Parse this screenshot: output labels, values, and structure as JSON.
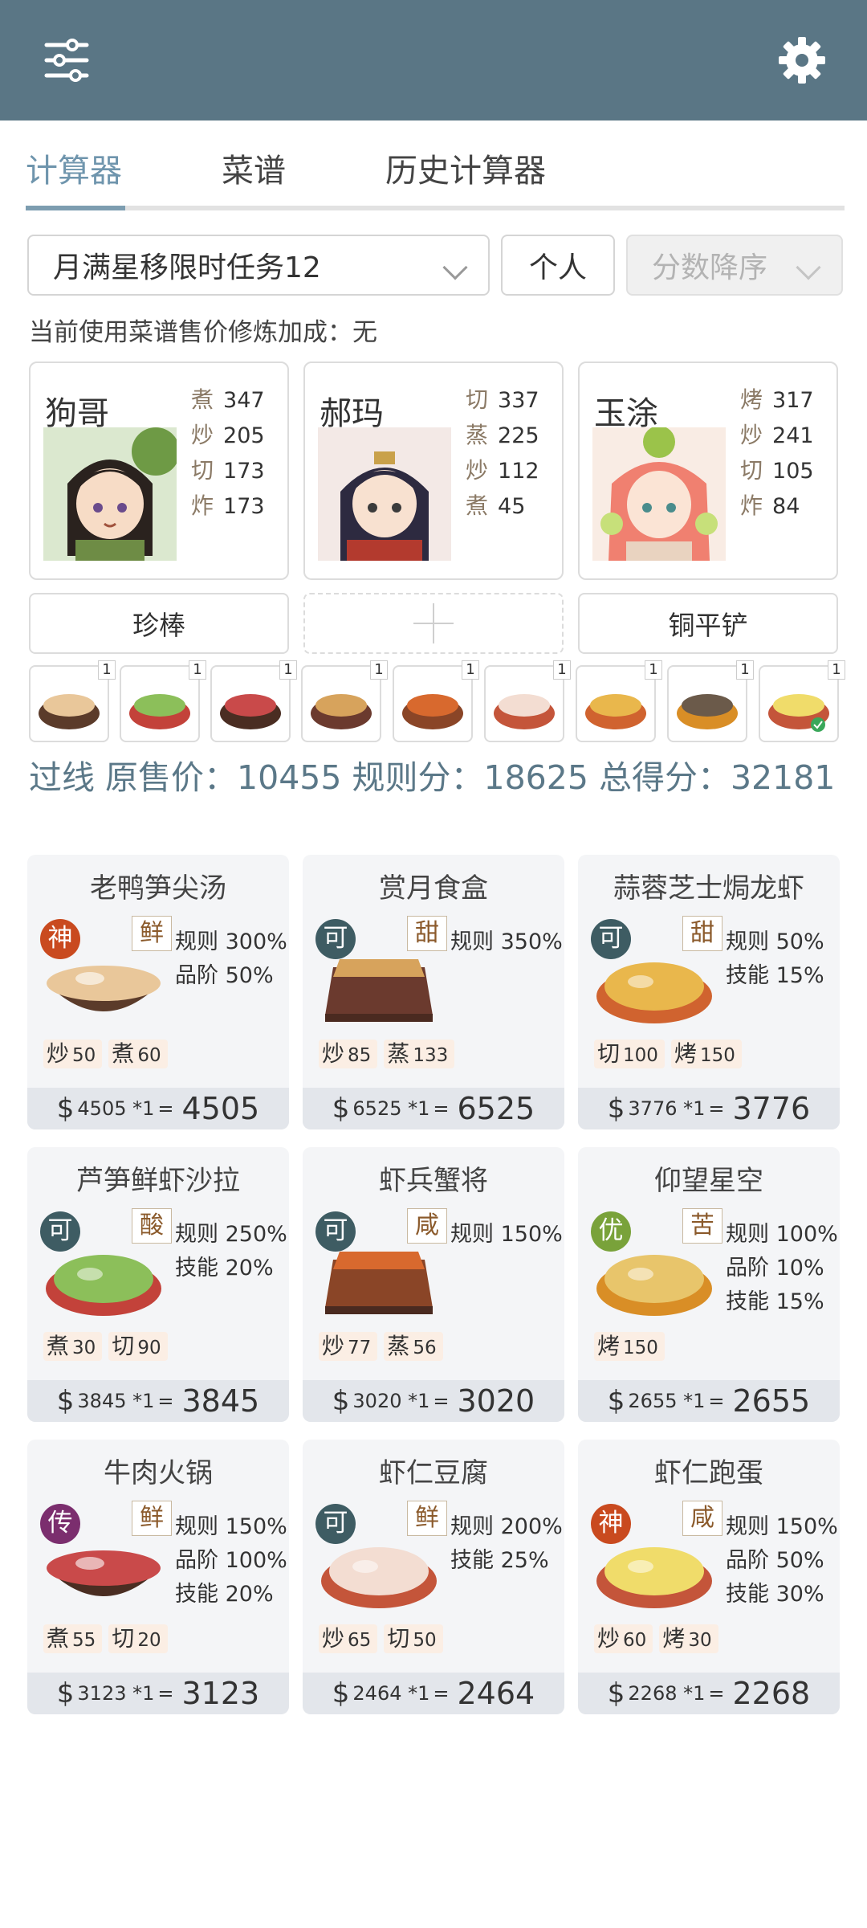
{
  "header": {
    "filter_icon": "sliders-icon",
    "settings_icon": "gear-icon"
  },
  "tabs": [
    {
      "label": "计算器",
      "active": true
    },
    {
      "label": "菜谱",
      "active": false
    },
    {
      "label": "历史计算器",
      "active": false
    }
  ],
  "controls": {
    "rule_select": "月满星移限时任务12",
    "mode_button": "个人",
    "sort_select": "分数降序"
  },
  "note": "当前使用菜谱售价修炼加成：无",
  "chefs": [
    {
      "name": "狗哥",
      "skills": [
        {
          "n": "煮",
          "v": "347"
        },
        {
          "n": "炒",
          "v": "205"
        },
        {
          "n": "切",
          "v": "173"
        },
        {
          "n": "炸",
          "v": "173"
        }
      ],
      "equip": "珍棒"
    },
    {
      "name": "郝玛",
      "skills": [
        {
          "n": "切",
          "v": "337"
        },
        {
          "n": "蒸",
          "v": "225"
        },
        {
          "n": "炒",
          "v": "112"
        },
        {
          "n": "煮",
          "v": "45"
        }
      ],
      "equip": ""
    },
    {
      "name": "玉涂",
      "skills": [
        {
          "n": "烤",
          "v": "317"
        },
        {
          "n": "炒",
          "v": "241"
        },
        {
          "n": "切",
          "v": "105"
        },
        {
          "n": "炸",
          "v": "84"
        }
      ],
      "equip": "铜平铲"
    }
  ],
  "slots": [
    "1",
    "1",
    "1",
    "1",
    "1",
    "1",
    "1",
    "1",
    "1"
  ],
  "summary": {
    "status": "过线",
    "text": " 原售价：10455 规则分：18625 总得分：32181"
  },
  "recipes": [
    {
      "name": "老鸭笋尖汤",
      "rarity": "神",
      "rcolor": "#c94a1f",
      "flavor": "鲜",
      "rules": [
        "规则 300%",
        "品阶 50%"
      ],
      "skills": [
        {
          "n": "炒",
          "v": "50"
        },
        {
          "n": "煮",
          "v": "60"
        }
      ],
      "unit": "4505 *1",
      "total": "4505",
      "dish": "bowl",
      "c1": "#5b3b2a",
      "c2": "#e9c79a"
    },
    {
      "name": "赏月食盒",
      "rarity": "可",
      "rcolor": "#3e5c63",
      "flavor": "甜",
      "rules": [
        "规则 350%"
      ],
      "skills": [
        {
          "n": "炒",
          "v": "85"
        },
        {
          "n": "蒸",
          "v": "133"
        }
      ],
      "unit": "6525 *1",
      "total": "6525",
      "dish": "box",
      "c1": "#6b3a2e",
      "c2": "#d7a35c"
    },
    {
      "name": "蒜蓉芝士焗龙虾",
      "rarity": "可",
      "rcolor": "#3e5c63",
      "flavor": "甜",
      "rules": [
        "规则 50%",
        "技能 15%"
      ],
      "skills": [
        {
          "n": "切",
          "v": "100"
        },
        {
          "n": "烤",
          "v": "150"
        }
      ],
      "unit": "3776 *1",
      "total": "3776",
      "dish": "plate",
      "c1": "#d0632f",
      "c2": "#e9b74c"
    },
    {
      "name": "芦笋鲜虾沙拉",
      "rarity": "可",
      "rcolor": "#3e5c63",
      "flavor": "酸",
      "rules": [
        "规则 250%",
        "技能 20%"
      ],
      "skills": [
        {
          "n": "煮",
          "v": "30"
        },
        {
          "n": "切",
          "v": "90"
        }
      ],
      "unit": "3845 *1",
      "total": "3845",
      "dish": "plate",
      "c1": "#c3423a",
      "c2": "#8cbf5a"
    },
    {
      "name": "虾兵蟹将",
      "rarity": "可",
      "rcolor": "#3e5c63",
      "flavor": "咸",
      "rules": [
        "规则 150%"
      ],
      "skills": [
        {
          "n": "炒",
          "v": "77"
        },
        {
          "n": "蒸",
          "v": "56"
        }
      ],
      "unit": "3020 *1",
      "total": "3020",
      "dish": "box",
      "c1": "#8a4527",
      "c2": "#d8692e"
    },
    {
      "name": "仰望星空",
      "rarity": "优",
      "rcolor": "#79a23a",
      "flavor": "苦",
      "rules": [
        "规则 100%",
        "品阶 10%",
        "技能 15%"
      ],
      "skills": [
        {
          "n": "烤",
          "v": "150"
        }
      ],
      "unit": "2655 *1",
      "total": "2655",
      "dish": "plate",
      "c1": "#d98e26",
      "c2": "#e8c56b"
    },
    {
      "name": "牛肉火锅",
      "rarity": "传",
      "rcolor": "#7b2e6e",
      "flavor": "鲜",
      "rules": [
        "规则 150%",
        "品阶 100%",
        "技能 20%"
      ],
      "skills": [
        {
          "n": "煮",
          "v": "55"
        },
        {
          "n": "切",
          "v": "20"
        }
      ],
      "unit": "3123 *1",
      "total": "3123",
      "dish": "bowl",
      "c1": "#4a2d22",
      "c2": "#c94a4a"
    },
    {
      "name": "虾仁豆腐",
      "rarity": "可",
      "rcolor": "#3e5c63",
      "flavor": "鲜",
      "rules": [
        "规则 200%",
        "技能 25%"
      ],
      "skills": [
        {
          "n": "炒",
          "v": "65"
        },
        {
          "n": "切",
          "v": "50"
        }
      ],
      "unit": "2464 *1",
      "total": "2464",
      "dish": "plate",
      "c1": "#c4553a",
      "c2": "#f3ddd2"
    },
    {
      "name": "虾仁跑蛋",
      "rarity": "神",
      "rcolor": "#c94a1f",
      "flavor": "咸",
      "rules": [
        "规则 150%",
        "品阶 50%",
        "技能 30%"
      ],
      "skills": [
        {
          "n": "炒",
          "v": "60"
        },
        {
          "n": "烤",
          "v": "30"
        }
      ],
      "unit": "2268 *1",
      "total": "2268",
      "dish": "plate",
      "c1": "#c4553a",
      "c2": "#f0dc6a"
    }
  ]
}
